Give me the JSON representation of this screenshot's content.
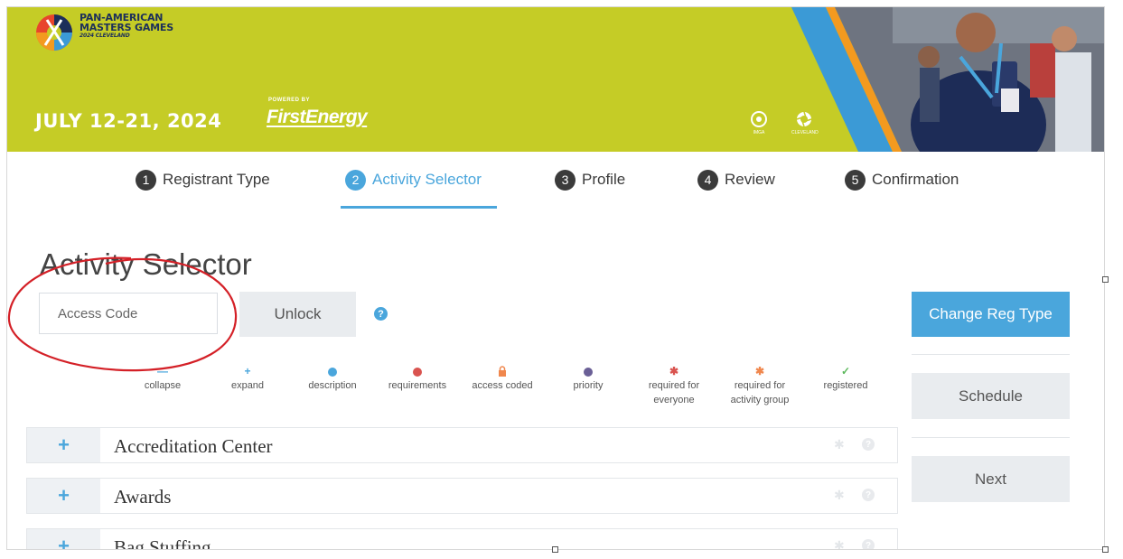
{
  "banner": {
    "brand_line1": "PAN-AMERICAN",
    "brand_line2": "MASTERS GAMES",
    "brand_sub": "2024 CLEVELAND",
    "dates": "JULY 12-21, 2024",
    "powered_by": "POWERED BY",
    "sponsor": "FirstEnergy",
    "org1_label": "IMGA",
    "org2_label": "CLEVELAND"
  },
  "steps": [
    {
      "num": "1",
      "label": "Registrant Type"
    },
    {
      "num": "2",
      "label": "Activity Selector"
    },
    {
      "num": "3",
      "label": "Profile"
    },
    {
      "num": "4",
      "label": "Review"
    },
    {
      "num": "5",
      "label": "Confirmation"
    }
  ],
  "page": {
    "title": "Activity Selector",
    "access_placeholder": "Access Code",
    "unlock_label": "Unlock",
    "help_glyph": "?"
  },
  "legend": [
    {
      "icon": "collapse-icon",
      "label": "collapse",
      "color": "#4aa6dc"
    },
    {
      "icon": "expand-icon",
      "label": "expand",
      "color": "#4aa6dc"
    },
    {
      "icon": "description-icon",
      "label": "description",
      "color": "#4aa6dc"
    },
    {
      "icon": "requirements-icon",
      "label": "requirements",
      "color": "#d9534f"
    },
    {
      "icon": "lock-icon",
      "label": "access coded",
      "color": "#f0874d"
    },
    {
      "icon": "priority-icon",
      "label": "priority",
      "color": "#6a5f96"
    },
    {
      "icon": "asterisk-icon",
      "label": "required for everyone",
      "color": "#d9534f"
    },
    {
      "icon": "asterisk-icon",
      "label": "required for activity group",
      "color": "#f0874d"
    },
    {
      "icon": "check-icon",
      "label": "registered",
      "color": "#5cb85c"
    }
  ],
  "activities": [
    {
      "name": "Accreditation Center"
    },
    {
      "name": "Awards"
    },
    {
      "name": "Bag Stuffing"
    }
  ],
  "sidebar": {
    "change_reg_label": "Change Reg Type",
    "schedule_label": "Schedule",
    "next_label": "Next"
  },
  "colors": {
    "banner": "#c5cc26",
    "accent": "#4aa6dc",
    "navy": "#1c2f5a"
  }
}
